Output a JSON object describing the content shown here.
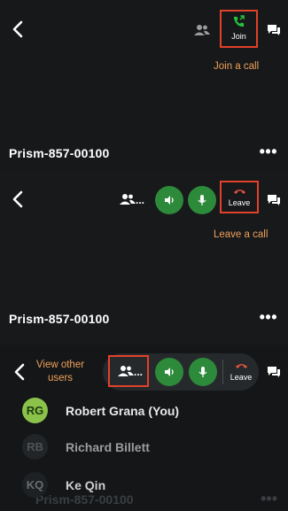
{
  "panel1": {
    "join_label": "Join",
    "annotation": "Join a call",
    "meeting_title": "Prism-857-00100",
    "more": "•••"
  },
  "panel2": {
    "leave_label": "Leave",
    "annotation": "Leave a call",
    "meeting_title": "Prism-857-00100",
    "more": "•••",
    "participants_ellipsis": "..."
  },
  "panel3": {
    "annotation": "View other users",
    "leave_label": "Leave",
    "participants_ellipsis": "...",
    "ghost_title": "Prism-857-00100",
    "ghost_more": "•••",
    "users": [
      {
        "initials": "RG",
        "name": "Robert Grana (You)",
        "avatar_bg": "#8bc34a",
        "avatar_fg": "#1b3a10",
        "text_color": "#e8e8e8"
      },
      {
        "initials": "RB",
        "name": "Richard Billett",
        "avatar_bg": "#222528",
        "avatar_fg": "#4f5356",
        "text_color": "#9a9c9e"
      },
      {
        "initials": "KQ",
        "name": "Ke Qin",
        "avatar_bg": "#1e2123",
        "avatar_fg": "#6b6e71",
        "text_color": "#d0d0d0"
      }
    ]
  },
  "colors": {
    "accent_green": "#2d8a3a",
    "join_icon_green": "#25c23a",
    "leave_icon_red": "#e5533d",
    "annotation_orange": "#f0a15a",
    "annotation_box_red": "#e2412b"
  }
}
